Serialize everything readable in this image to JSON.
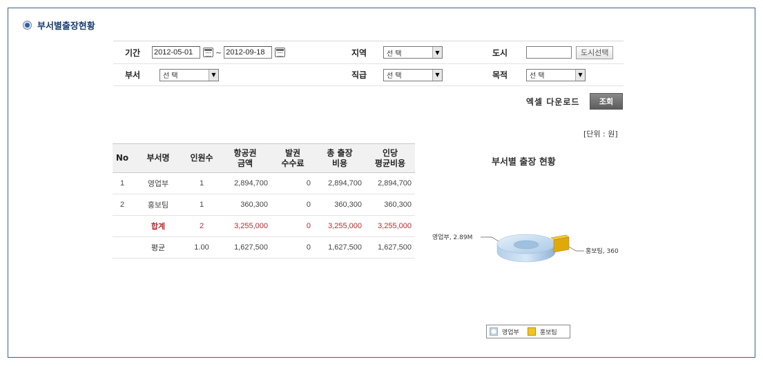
{
  "section": {
    "title": "부서별출장현황"
  },
  "filters": {
    "period_label": "기간",
    "date_from": "2012-05-01",
    "date_sep": "~",
    "date_to": "2012-09-18",
    "region_label": "지역",
    "region_value": "선 택",
    "city_label": "도시",
    "city_value": "",
    "city_select_button": "도시선택",
    "dept_label": "부서",
    "dept_value": "선 택",
    "rank_label": "직급",
    "rank_value": "선 택",
    "purpose_label": "목적",
    "purpose_value": "선 택"
  },
  "actions": {
    "excel_download": "엑셀 다운로드",
    "search": "조회"
  },
  "unit_note": "[단위 : 원]",
  "table": {
    "headers": {
      "no": "No",
      "dept": "부서명",
      "headcount": "인원수",
      "airfare_1": "항공권",
      "airfare_2": "금액",
      "fee_1": "발권",
      "fee_2": "수수료",
      "total_1": "총 출장",
      "total_2": "비용",
      "avg_1": "인당",
      "avg_2": "평균비용"
    },
    "rows": [
      {
        "no": "1",
        "dept": "영업부",
        "headcount": "1",
        "airfare": "2,894,700",
        "fee": "0",
        "total": "2,894,700",
        "avg": "2,894,700"
      },
      {
        "no": "2",
        "dept": "홍보팀",
        "headcount": "1",
        "airfare": "360,300",
        "fee": "0",
        "total": "360,300",
        "avg": "360,300"
      }
    ],
    "total": {
      "label": "합계",
      "headcount": "2",
      "airfare": "3,255,000",
      "fee": "0",
      "total": "3,255,000",
      "avg": "3,255,000"
    },
    "average": {
      "label": "평균",
      "headcount": "1.00",
      "airfare": "1,627,500",
      "fee": "0",
      "total": "1,627,500",
      "avg": "1,627,500"
    }
  },
  "chart_data": {
    "type": "pie",
    "title": "부서별 출장 현황",
    "categories": [
      "영업부",
      "홍보팀"
    ],
    "values": [
      2894700,
      360300
    ],
    "labels": [
      "영업부, 2.89M",
      "홍보팀, 360"
    ],
    "colors": [
      "#b8d3ea",
      "#e0a90a"
    ],
    "legend": "bottom"
  }
}
